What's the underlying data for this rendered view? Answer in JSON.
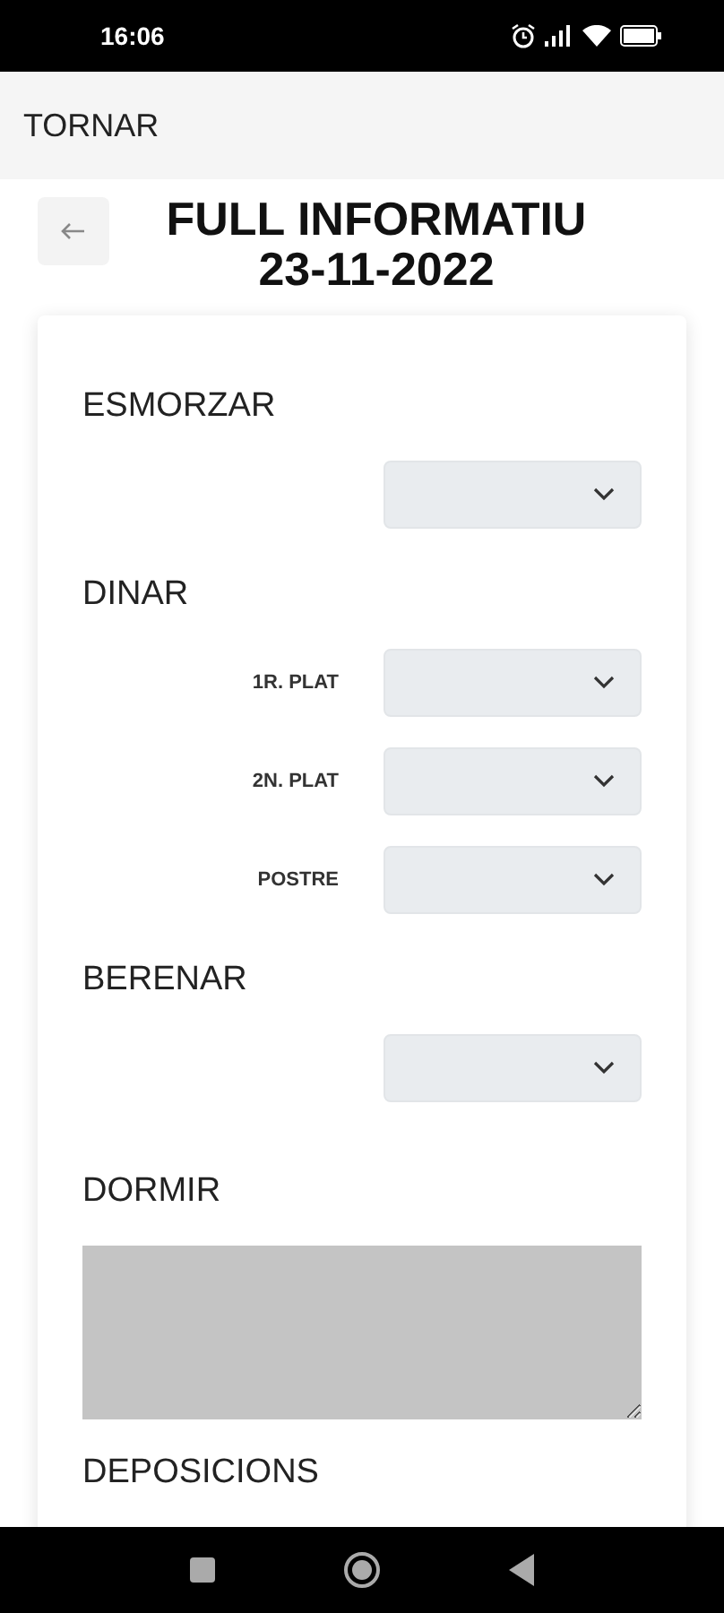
{
  "status_bar": {
    "time": "16:06"
  },
  "app_bar": {
    "title": "TORNAR"
  },
  "header": {
    "title_lines": [
      "FULL INFORMATIU",
      "23-11-2022"
    ]
  },
  "sections": [
    {
      "heading": "ESMORZAR",
      "kind": "selects",
      "fields": [
        {
          "kind": "dropdown"
        }
      ]
    },
    {
      "heading": "DINAR",
      "kind": "selects",
      "fields": [
        {
          "kind": "dropdown",
          "label": "1R. PLAT"
        },
        {
          "kind": "dropdown",
          "label": "2N. PLAT"
        },
        {
          "kind": "dropdown",
          "label": "POSTRE"
        }
      ]
    },
    {
      "heading": "BERENAR",
      "kind": "selects",
      "fields": [
        {
          "kind": "dropdown"
        }
      ]
    },
    {
      "heading": "DORMIR",
      "kind": "textarea"
    },
    {
      "heading": "DEPOSICIONS",
      "kind": "heading"
    }
  ]
}
